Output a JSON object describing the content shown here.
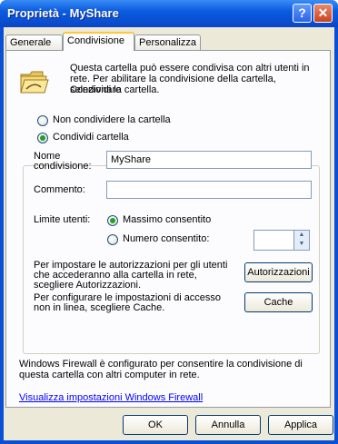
{
  "window": {
    "title": "Proprietà - MyShare",
    "help_label": "?",
    "close_label": "✕"
  },
  "tabs": [
    {
      "label": "Generale",
      "active": false
    },
    {
      "label": "Condivisione",
      "active": true
    },
    {
      "label": "Personalizza",
      "active": false
    }
  ],
  "intro": {
    "icon": "folder-share-icon",
    "text1": "Questa cartella può essere condivisa con altri utenti in",
    "text2": "rete. Per abilitare la condivisione della cartella, selezionare",
    "text3": "Condividi la cartella."
  },
  "options": {
    "no_share": "Non condividere la cartella",
    "share": "Condividi cartella",
    "selected": "share"
  },
  "fields": {
    "share_name_label1": "Nome",
    "share_name_label2": "condivisione:",
    "share_name_value": "MyShare",
    "comment_label": "Commento:",
    "comment_value": ""
  },
  "user_limit": {
    "label": "Limite utenti:",
    "max_allowed": "Massimo consentito",
    "number_allowed": "Numero consentito:",
    "selected": "max",
    "number_value": ""
  },
  "permissions": {
    "line1": "Per impostare le autorizzazioni per gli utenti",
    "line2": "che accederanno alla cartella in rete,",
    "line3": "scegliere Autorizzazioni.",
    "button": "Autorizzazioni"
  },
  "cache": {
    "line1": "Per configurare le impostazioni di accesso",
    "line2": "non in linea, scegliere Cache.",
    "button": "Cache"
  },
  "firewall": {
    "line1": "Windows Firewall è configurato per consentire la condivisione di",
    "line2": "questa cartella con altri computer in rete.",
    "link": "Visualizza impostazioni Windows Firewall"
  },
  "footer": {
    "ok": "OK",
    "cancel": "Annulla",
    "apply": "Applica"
  },
  "colors": {
    "accent": "#21a121",
    "title_bar": "#0a4fd4",
    "link": "#0000ff"
  }
}
